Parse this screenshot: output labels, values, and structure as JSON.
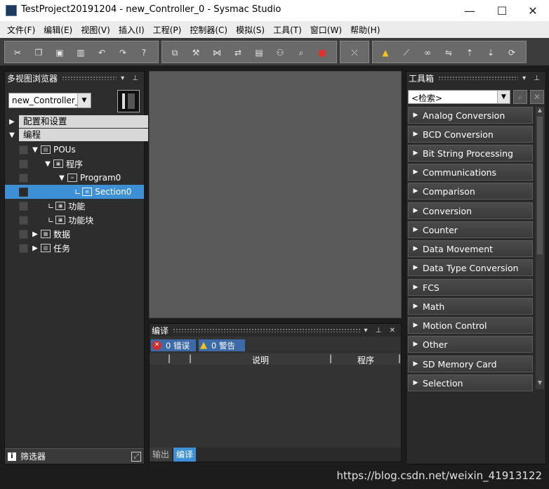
{
  "window": {
    "title": "TestProject20191204 - new_Controller_0 - Sysmac Studio",
    "minimize": "—",
    "maximize": "☐",
    "close": "✕"
  },
  "menu": [
    "文件(F)",
    "编辑(E)",
    "视图(V)",
    "插入(I)",
    "工程(P)",
    "控制器(C)",
    "模拟(S)",
    "工具(T)",
    "窗口(W)",
    "帮助(H)"
  ],
  "toolbar": {
    "group1_icons": [
      "cut-icon",
      "copy-icon",
      "paste-icon",
      "delete-icon",
      "undo-icon",
      "redo-icon",
      "help-icon"
    ],
    "group2_icons": [
      "cross-reference-icon",
      "build-icon",
      "network-icon",
      "transfer-icon",
      "monitor-icon",
      "controller-icon",
      "search-icon",
      "stop-icon"
    ],
    "group3_icons": [
      "offline-icon"
    ],
    "group4_icons": [
      "warning-icon",
      "simulation-icon",
      "online-icon",
      "sync-icon",
      "upload-icon",
      "download-icon",
      "reset-icon"
    ]
  },
  "left_panel": {
    "title": "多视图浏览器",
    "controller_select": "new_Controller_0",
    "sections": {
      "config": "配置和设置",
      "programming": "编程"
    },
    "tree": {
      "pous": "POUs",
      "programs": "程序",
      "program0": "Program0",
      "section0": "Section0",
      "functions": "功能",
      "function_blocks": "功能块",
      "data": "数据",
      "tasks": "任务"
    },
    "filter": "筛选器"
  },
  "output_panel": {
    "title": "编译",
    "errors": "0  错误",
    "warnings": "0  警告",
    "col_description": "说明",
    "col_program": "程序",
    "tab_output": "输出",
    "tab_compile": "编译"
  },
  "toolbox": {
    "title": "工具箱",
    "search_placeholder": "<检索>",
    "items": [
      "Analog Conversion",
      "BCD Conversion",
      "Bit String Processing",
      "Communications",
      "Comparison",
      "Conversion",
      "Counter",
      "Data Movement",
      "Data Type Conversion",
      "FCS",
      "Math",
      "Motion Control",
      "Other",
      "SD Memory Card",
      "Selection"
    ]
  },
  "watermark": "https://blog.csdn.net/weixin_41913122",
  "colors": {
    "selection": "#3d8fd6",
    "toolbox_item": "#404040",
    "panel_bg": "#2d2d2d",
    "center_bg": "#5a5a5a"
  }
}
